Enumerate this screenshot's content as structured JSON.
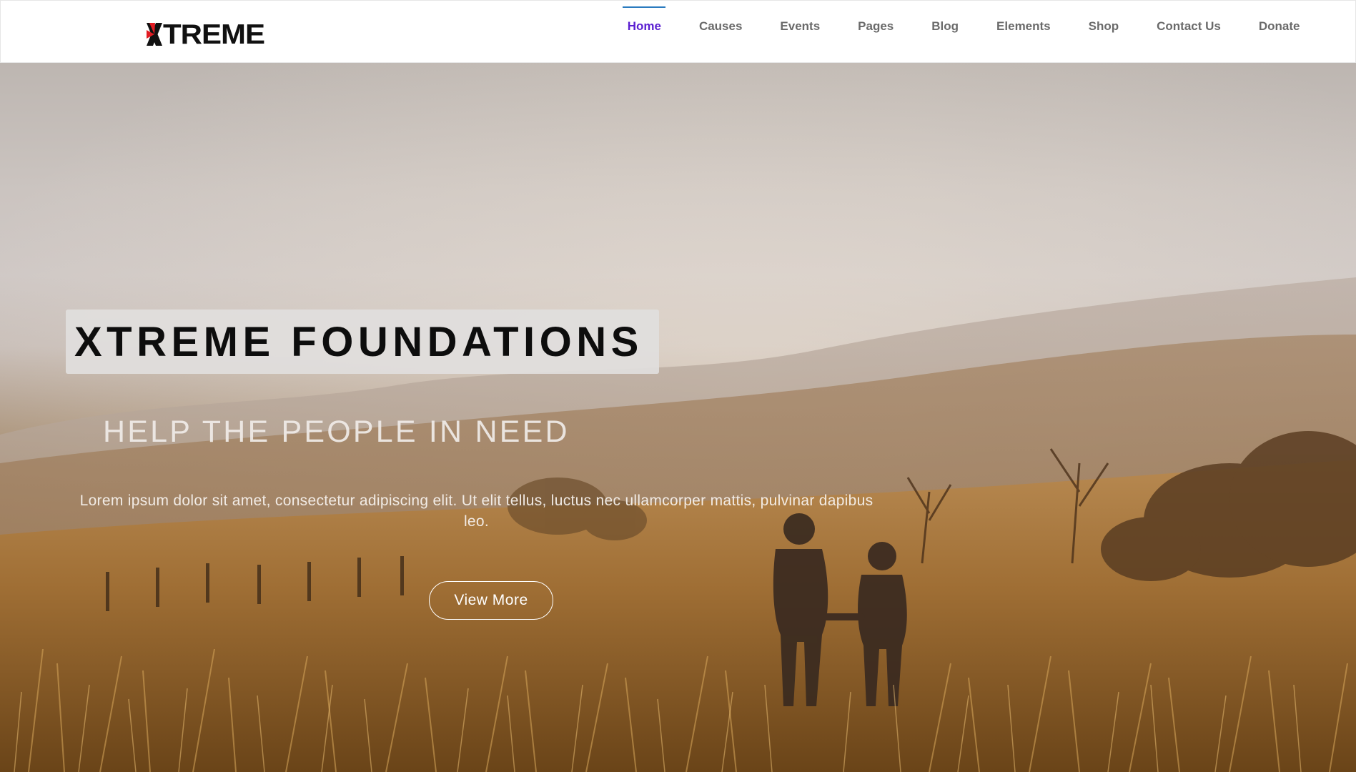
{
  "header": {
    "logo_text": "TREME",
    "logo_mark": "X"
  },
  "nav": {
    "items": [
      {
        "label": "Home",
        "active": true
      },
      {
        "label": "Causes"
      },
      {
        "label": "Events"
      },
      {
        "label": "Pages"
      },
      {
        "label": "Blog"
      },
      {
        "label": "Elements"
      },
      {
        "label": "Shop"
      },
      {
        "label": "Contact Us"
      },
      {
        "label": "Donate"
      }
    ]
  },
  "hero": {
    "title": "XTREME FOUNDATIONS",
    "subtitle": "HELP THE PEOPLE IN NEED",
    "text": "Lorem ipsum dolor sit amet, consectetur adipiscing elit. Ut elit tellus, luctus nec ullamcorper mattis, pulvinar dapibus leo.",
    "button_label": "View More"
  },
  "colors": {
    "nav_active": "#5b1fd1",
    "nav_indicator": "#2b7bbf",
    "nav_text": "#6a6a6a",
    "logo_red": "#e11b22",
    "logo_black": "#111111"
  }
}
